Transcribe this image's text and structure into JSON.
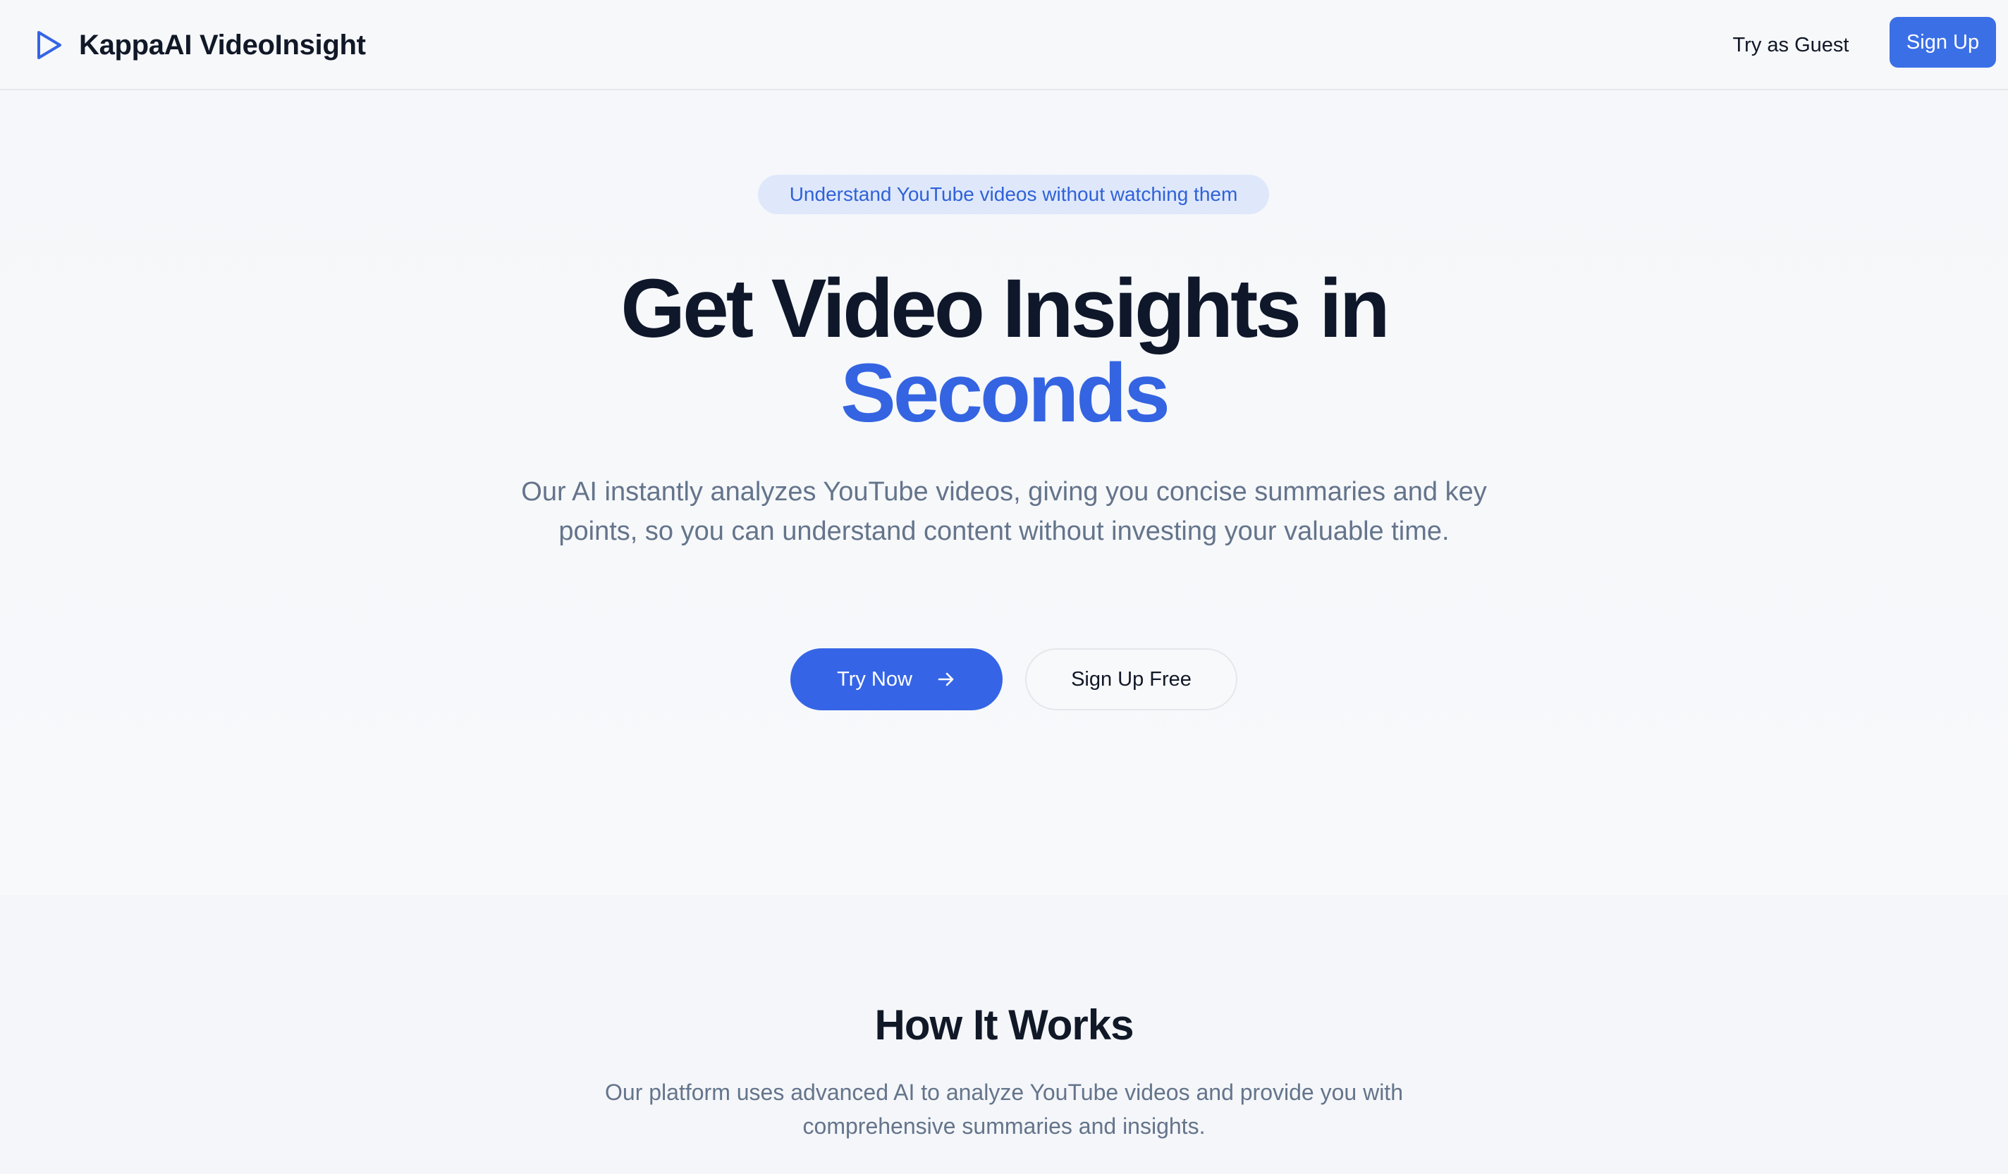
{
  "nav": {
    "brand": "KappaAI VideoInsight",
    "brand_icon": "play-icon",
    "guest_label": "Try as Guest",
    "signup_label": "Sign Up"
  },
  "hero": {
    "badge": "Understand YouTube videos without watching them",
    "title_main": "Get Video Insights in",
    "title_accent": "Seconds",
    "subtitle": "Our AI instantly analyzes YouTube videos, giving you concise summaries and key points, so you can understand content without investing your valuable time.",
    "cta_primary": "Try Now",
    "cta_primary_icon": "arrow-right-icon",
    "cta_secondary": "Sign Up Free"
  },
  "how_it_works": {
    "title": "How It Works",
    "subtitle": "Our platform uses advanced AI to analyze YouTube videos and provide you with comprehensive summaries and insights."
  },
  "colors": {
    "accent": "#3565e6",
    "badge_bg": "#dfe8fb",
    "text_dark": "#0f172a",
    "text_muted": "#64748b",
    "background": "#f6f7f9"
  }
}
